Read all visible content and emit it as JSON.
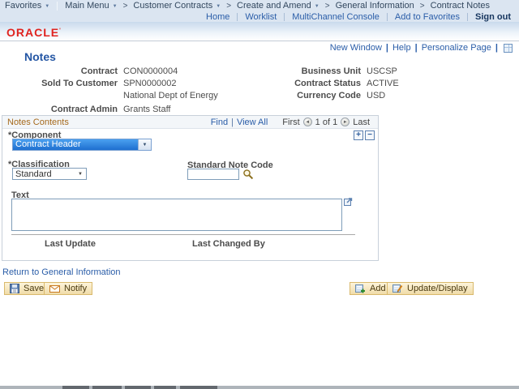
{
  "colors": {
    "oracle_red": "#e0231f",
    "link_blue": "#2a5da8",
    "section_title_orange": "#a5691c",
    "header_bg": "#dbe5f1",
    "button_bg": "#f5e4b4",
    "select_highlight_blue": "#2f7bd6"
  },
  "icons": {
    "caret_down": "▼",
    "dropdown_arrow": "▼",
    "separator": ">",
    "pipe": "|",
    "prev_arrow": "◄",
    "next_arrow": "►",
    "plus": "+",
    "minus": "−"
  },
  "breadcrumb": {
    "favorites": "Favorites",
    "main_menu": "Main Menu",
    "items": [
      "Customer Contracts",
      "Create and Amend",
      "General Information",
      "Contract Notes"
    ]
  },
  "header_links": {
    "home": "Home",
    "worklist": "Worklist",
    "multichannel": "MultiChannel Console",
    "add_to_favorites": "Add to Favorites",
    "sign_out": "Sign out"
  },
  "brand": {
    "logo": "ORACLE"
  },
  "page_links": {
    "new_window": "New Window",
    "help": "Help",
    "personalize_page": "Personalize Page"
  },
  "page": {
    "title": "Notes"
  },
  "contract_info": {
    "rows": [
      {
        "l_label": "Contract",
        "l_value": "CON0000004",
        "r_label": "Business Unit",
        "r_value": "USCSP"
      },
      {
        "l_label": "Sold To Customer",
        "l_value": "SPN0000002",
        "r_label": "Contract Status",
        "r_value": "ACTIVE"
      },
      {
        "l_label": "",
        "l_value": "National Dept of Energy",
        "r_label": "Currency Code",
        "r_value": "USD"
      },
      {
        "l_label": "Contract Admin",
        "l_value": "Grants Staff",
        "r_label": "",
        "r_value": ""
      }
    ]
  },
  "notes": {
    "title": "Notes Contents",
    "find": "Find",
    "view_all": "View All",
    "first": "First",
    "count": "1 of 1",
    "last": "Last",
    "component_label": "*Component",
    "component_value": "Contract Header",
    "classification_label": "*Classification",
    "classification_value": "Standard",
    "note_code_label": "Standard Note Code",
    "note_code_value": "",
    "text_label": "Text",
    "text_value": "",
    "last_update_label": "Last Update",
    "last_changed_by_label": "Last Changed By"
  },
  "footer": {
    "return_link": "Return to General Information"
  },
  "toolbar": {
    "save": "Save",
    "notify": "Notify",
    "add": "Add",
    "update_display": "Update/Display"
  }
}
